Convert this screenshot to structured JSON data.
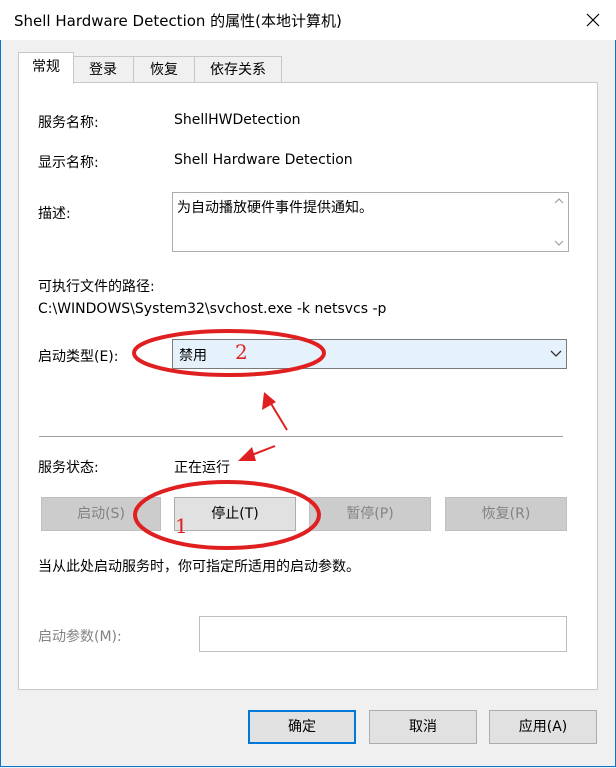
{
  "window": {
    "title": "Shell Hardware Detection 的属性(本地计算机)"
  },
  "tabs": [
    {
      "label": "常规",
      "active": true
    },
    {
      "label": "登录",
      "active": false
    },
    {
      "label": "恢复",
      "active": false
    },
    {
      "label": "依存关系",
      "active": false
    }
  ],
  "general": {
    "service_name_label": "服务名称:",
    "service_name_value": "ShellHWDetection",
    "display_name_label": "显示名称:",
    "display_name_value": "Shell Hardware Detection",
    "description_label": "描述:",
    "description_value": "为自动播放硬件事件提供通知。",
    "exe_path_label": "可执行文件的路径:",
    "exe_path_value": "C:\\WINDOWS\\System32\\svchost.exe -k netsvcs -p",
    "startup_type_label": "启动类型(E):",
    "startup_type_value": "禁用",
    "service_status_label": "服务状态:",
    "service_status_value": "正在运行",
    "buttons": {
      "start": "启动(S)",
      "stop": "停止(T)",
      "pause": "暂停(P)",
      "resume": "恢复(R)"
    },
    "hint_text": "当从此处启动服务时，你可指定所适用的启动参数。",
    "start_params_label": "启动参数(M):",
    "start_params_value": ""
  },
  "footer": {
    "ok": "确定",
    "cancel": "取消",
    "apply": "应用(A)"
  },
  "annotations": {
    "num1": "1",
    "num2": "2",
    "color": "#e02020"
  },
  "colors": {
    "accent": "#0078d7",
    "select_bg": "#e5f1fb",
    "disabled_text": "#838383"
  }
}
